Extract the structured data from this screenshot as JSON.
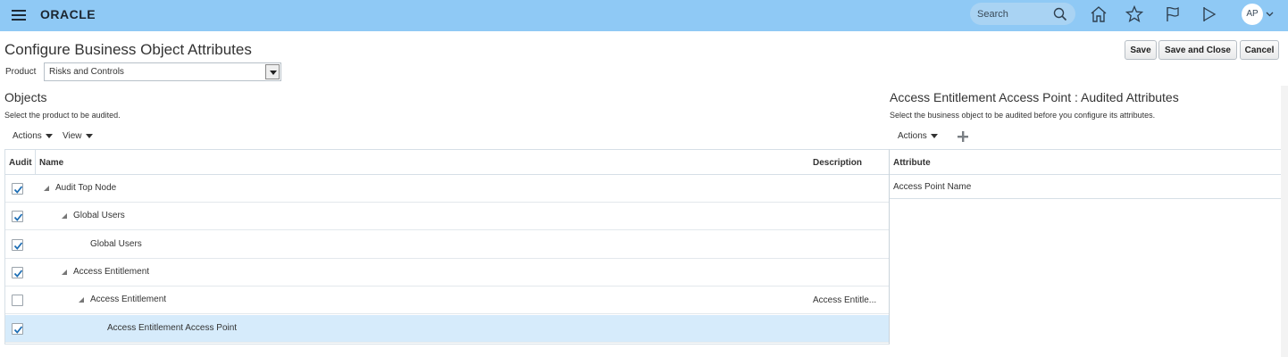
{
  "header": {
    "logo_text": "ORACLE",
    "search_placeholder": "Search",
    "avatar_initials": "AP",
    "icons": [
      "menu-icon",
      "search-icon",
      "home-icon",
      "star-icon",
      "flag-icon",
      "play-flag-icon",
      "chevron-down-icon"
    ],
    "bar_color": "#8fc9f5"
  },
  "page": {
    "title": "Configure Business Object Attributes",
    "product_label": "Product",
    "product_value": "Risks and Controls",
    "buttons": {
      "save": "Save",
      "save_and_close": "Save and Close",
      "cancel": "Cancel"
    }
  },
  "objects": {
    "title": "Objects",
    "description": "Select the product to be audited.",
    "toolbar": {
      "actions": "Actions",
      "view": "View"
    },
    "columns": {
      "audit": "Audit",
      "name": "Name",
      "description": "Description"
    },
    "rows": [
      {
        "name": "Audit Top Node",
        "checked": true,
        "expandable": true,
        "description": ""
      },
      {
        "name": "Global Users",
        "checked": true,
        "expandable": true,
        "description": ""
      },
      {
        "name": "Global Users",
        "checked": true,
        "expandable": false,
        "description": ""
      },
      {
        "name": "Access Entitlement",
        "checked": true,
        "expandable": true,
        "description": ""
      },
      {
        "name": "Access Entitlement",
        "checked": false,
        "expandable": true,
        "description": "Access Entitle..."
      },
      {
        "name": "Access Entitlement Access Point",
        "checked": true,
        "expandable": false,
        "description": "",
        "selected": true
      }
    ]
  },
  "attributes": {
    "title": "Access Entitlement Access Point : Audited Attributes",
    "description": "Select the business object to be audited before you configure its attributes.",
    "toolbar": {
      "actions": "Actions"
    },
    "columns": {
      "attribute": "Attribute"
    },
    "rows": [
      {
        "attribute": "Access Point Name"
      }
    ]
  },
  "colors": {
    "accent": "#8fc9f5",
    "selected_row": "#d6ebfb",
    "checkmark": "#1f6fb5"
  }
}
